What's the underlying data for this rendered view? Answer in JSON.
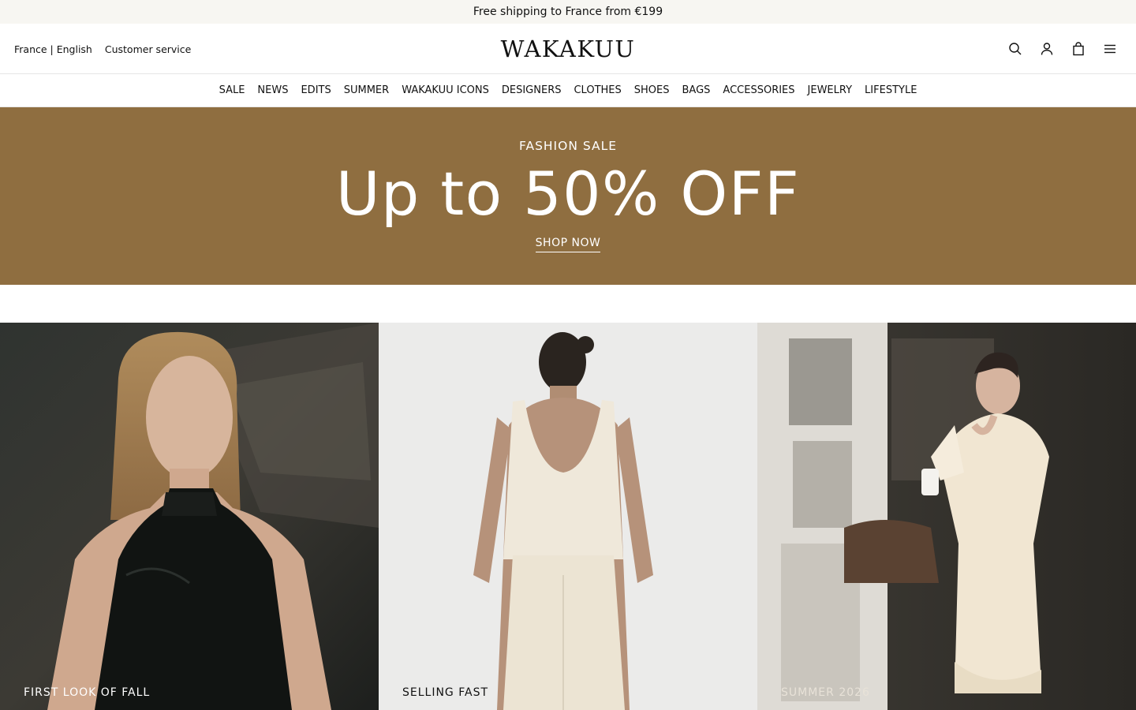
{
  "announcement": "Free shipping to France from €199",
  "header": {
    "locale": "France | English",
    "customer_service": "Customer service",
    "logo": "WAKAKUU",
    "icons": [
      "search-icon",
      "account-icon",
      "bag-icon",
      "menu-icon"
    ]
  },
  "nav": [
    {
      "label": "SALE"
    },
    {
      "label": "NEWS"
    },
    {
      "label": "EDITS"
    },
    {
      "label": "SUMMER"
    },
    {
      "label": "WAKAKUU ICONS"
    },
    {
      "label": "DESIGNERS"
    },
    {
      "label": "CLOTHES"
    },
    {
      "label": "SHOES"
    },
    {
      "label": "BAGS"
    },
    {
      "label": "ACCESSORIES"
    },
    {
      "label": "JEWELRY"
    },
    {
      "label": "LIFESTYLE"
    }
  ],
  "hero": {
    "eyebrow": "FASHION SALE",
    "title": "Up to 50% OFF",
    "cta": "SHOP NOW",
    "background": "#8f6e40"
  },
  "tiles": [
    {
      "label": "FIRST LOOK OF FALL"
    },
    {
      "label": "SELLING FAST"
    },
    {
      "label": "SUMMER 2026"
    }
  ]
}
